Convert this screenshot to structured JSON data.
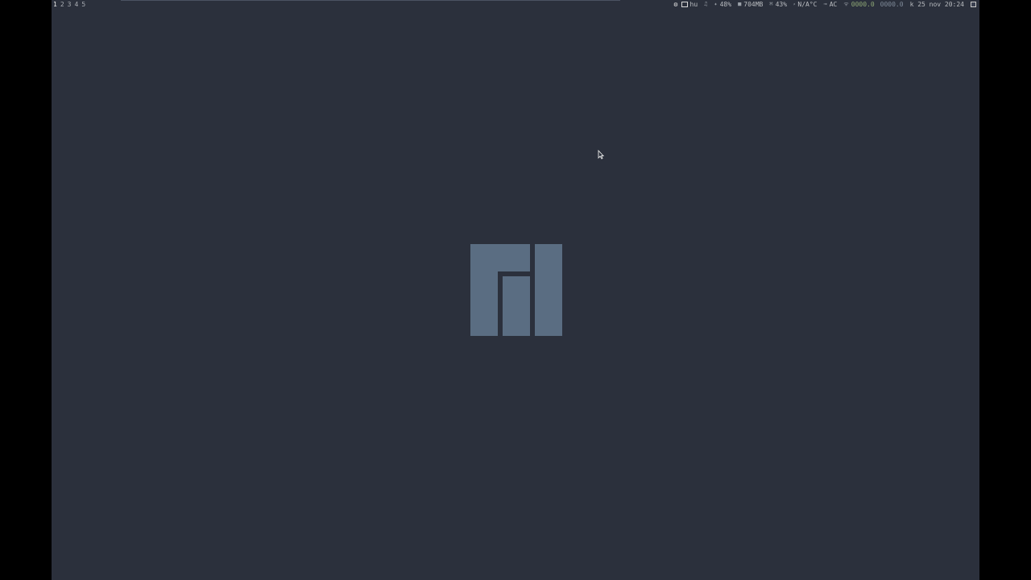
{
  "workspaces": [
    "1",
    "2",
    "3",
    "4",
    "5"
  ],
  "active_workspace": "1",
  "tray": {
    "settings_icon": "gear-icon",
    "keyboard_icon": "keyboard-icon",
    "layout": "hu"
  },
  "status": {
    "volume_icon": "music-note-icon",
    "volume": "",
    "brightness_icon": "sun-icon",
    "brightness": "48%",
    "memory_icon": "memory-icon",
    "memory": "704MB",
    "cpu_icon": "cpu-icon",
    "cpu": "43%",
    "temp_icon": "thermometer-icon",
    "temp": "N/A°C",
    "power_icon": "plug-icon",
    "power": "AC",
    "net_icon": "wifi-icon",
    "net_down": "0000.0",
    "net_up": "0000.0",
    "datetime": "k 25 nov 20:24"
  },
  "colors": {
    "desktop": "#2b303c",
    "logo": "#5a6d82",
    "net_down": "#8fa876"
  }
}
